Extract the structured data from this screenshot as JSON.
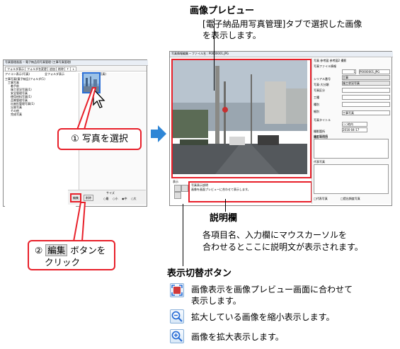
{
  "left_screenshot": {
    "title": "写真管理画面 ─ 電子納品用写真管理 (工事写真管理)",
    "tabs": [
      "フォルダ表示",
      "フォルダ名変更",
      "追加",
      "削除",
      "↑",
      "↓"
    ],
    "subtabs": [
      "アイコン表示(写真)",
      "全フォルダ表示",
      "アイコン表示(写真)"
    ],
    "tree_items": [
      "工事写真(電子納品)フォルダ(1)",
      "工事写真",
      "着手前",
      "施工状況写真(1)",
      "安全管理写真",
      "使用材料写真(1)",
      "品質管理写真",
      "出来形管理写真(1)",
      "災害写真",
      "その他",
      "完成写真"
    ],
    "bottom_buttons": [
      "編集",
      "削除"
    ],
    "size_label": "サイズ",
    "size_options": [
      "最",
      "小",
      "中",
      "大"
    ]
  },
  "callout_1": {
    "number": "①",
    "text": "写真を選択"
  },
  "callout_2": {
    "number": "②",
    "button": "編集",
    "text_after": "ボタンを",
    "line2": "クリック"
  },
  "right_screenshot": {
    "title": "写真情報編集 ─ ファイル名 : P0000001.JPG",
    "tabs": [
      "写真",
      "参考図",
      "参考図2",
      "撮影"
    ],
    "form": [
      {
        "label": "写真ファイル情報",
        "value": ""
      },
      {
        "label": "シリアル番号",
        "value": "1"
      },
      {
        "label": "写真ファイル名",
        "value": "P0000001.JPG"
      },
      {
        "label": "写真-大分類",
        "value": "工事"
      },
      {
        "label": "写真区分",
        "value": "施工状況写真"
      },
      {
        "label": "工種",
        "value": ""
      },
      {
        "label": "種別",
        "value": ""
      },
      {
        "label": "細別",
        "value": ""
      },
      {
        "label": "写真タイトル",
        "value": "工事写真"
      },
      {
        "label": "撮影箇所",
        "value": "○○地内"
      },
      {
        "label": "撮影年月日",
        "value": "2016-04-17"
      }
    ],
    "remarks_label": "施工管理値",
    "extra_label": "代表写真",
    "checkbox_labels": [
      "代表写真",
      "提出頻度写真"
    ],
    "desc_title": "写真表示説明",
    "desc_text": "画像を画面プレビューに合わせて表示します。",
    "view_label": "表示"
  },
  "annotations": {
    "preview_heading": "画像プレビュー",
    "preview_body_1": "[電子納品用写真管理]タブで選択した画像",
    "preview_body_2": "を表示します。",
    "desc_heading": "説明欄",
    "desc_body_1": "各項目名、入力欄にマウスカーソルを",
    "desc_body_2": "合わせるとここに説明文が表示されます。",
    "toggle_heading": "表示切替ボタン",
    "toggle_items": [
      {
        "icon": "fit-screen-icon",
        "text_1": "画像表示を画像プレビュー画面に合わせて",
        "text_2": "表示します。"
      },
      {
        "icon": "zoom-out-icon",
        "text_1": "拡大している画像を縮小表示します。",
        "text_2": ""
      },
      {
        "icon": "zoom-in-icon",
        "text_1": "画像を拡大表示します。",
        "text_2": ""
      }
    ]
  },
  "colors": {
    "accent_red": "#e8202a",
    "arrow_blue": "#2f86d6",
    "icon_blue": "#2b6fd6"
  }
}
